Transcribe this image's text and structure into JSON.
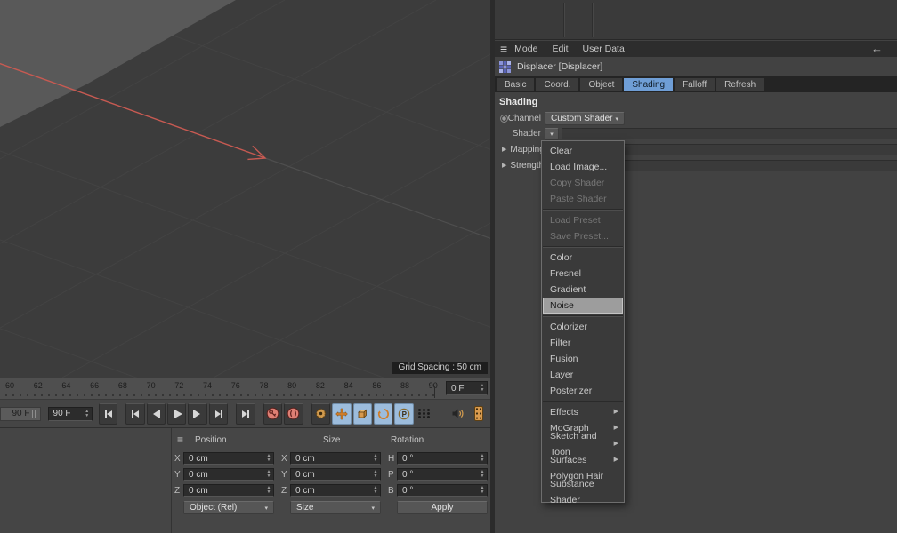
{
  "icons": {
    "hamburger": "≡",
    "back_arrow": "←",
    "chevron_down": "▾",
    "spin_up": "▲",
    "spin_down": "▼",
    "collapsed_arrow": "▶",
    "submenu_arrow": "▶"
  },
  "viewport": {
    "grid_spacing_label": "Grid Spacing : 50 cm"
  },
  "timeline": {
    "ticks": [
      "60",
      "62",
      "64",
      "66",
      "68",
      "70",
      "72",
      "74",
      "76",
      "78",
      "80",
      "82",
      "84",
      "86",
      "88",
      "90"
    ],
    "current_frame": "0 F",
    "range_end_slider": "90 F",
    "range_end_field": "90 F"
  },
  "coordinates": {
    "columns": [
      "Position",
      "Size",
      "Rotation"
    ],
    "position": {
      "x_label": "X",
      "y_label": "Y",
      "z_label": "Z",
      "x": "0 cm",
      "y": "0 cm",
      "z": "0 cm"
    },
    "size": {
      "x_label": "X",
      "y_label": "Y",
      "z_label": "Z",
      "x": "0 cm",
      "y": "0 cm",
      "z": "0 cm"
    },
    "rotation": {
      "h_label": "H",
      "p_label": "P",
      "b_label": "B",
      "h": "0 °",
      "p": "0 °",
      "b": "0 °"
    },
    "position_space": "Object (Rel)",
    "size_mode": "Size",
    "apply_label": "Apply"
  },
  "attributes": {
    "menu": {
      "mode": "Mode",
      "edit": "Edit",
      "user_data": "User Data"
    },
    "title": "Displacer [Displacer]",
    "tabs": [
      {
        "label": "Basic"
      },
      {
        "label": "Coord."
      },
      {
        "label": "Object"
      },
      {
        "label": "Shading"
      },
      {
        "label": "Falloff"
      },
      {
        "label": "Refresh"
      }
    ],
    "active_tab": "Shading",
    "section_heading": "Shading",
    "channel_label": "Channel",
    "channel_value": "Custom Shader",
    "shader_label": "Shader",
    "group_rows": [
      {
        "label": "Mapping"
      },
      {
        "label": "Strength"
      }
    ]
  },
  "context_menu": {
    "items": [
      {
        "label": "Clear"
      },
      {
        "label": "Load Image..."
      },
      {
        "label": "Copy Shader",
        "disabled": true
      },
      {
        "label": "Paste Shader",
        "disabled": true
      },
      {
        "label": "Load Preset",
        "disabled": true
      },
      {
        "label": "Save Preset...",
        "disabled": true
      },
      {
        "label": "Color"
      },
      {
        "label": "Fresnel"
      },
      {
        "label": "Gradient"
      },
      {
        "label": "Noise",
        "selected": true
      },
      {
        "label": "Colorizer"
      },
      {
        "label": "Filter"
      },
      {
        "label": "Fusion"
      },
      {
        "label": "Layer"
      },
      {
        "label": "Posterizer"
      },
      {
        "label": "Effects",
        "submenu": true
      },
      {
        "label": "MoGraph",
        "submenu": true
      },
      {
        "label": "Sketch and Toon",
        "submenu": true
      },
      {
        "label": "Surfaces",
        "submenu": true
      },
      {
        "label": "Polygon Hair"
      },
      {
        "label": "Substance Shader"
      }
    ]
  },
  "colors": {
    "accent_blue": "#6f9ed6",
    "axis_red": "#c75a52",
    "record_red": "#dd7f74",
    "icon_orange": "#d89a4e",
    "toggle_blue_bg": "#9cbcdc"
  }
}
